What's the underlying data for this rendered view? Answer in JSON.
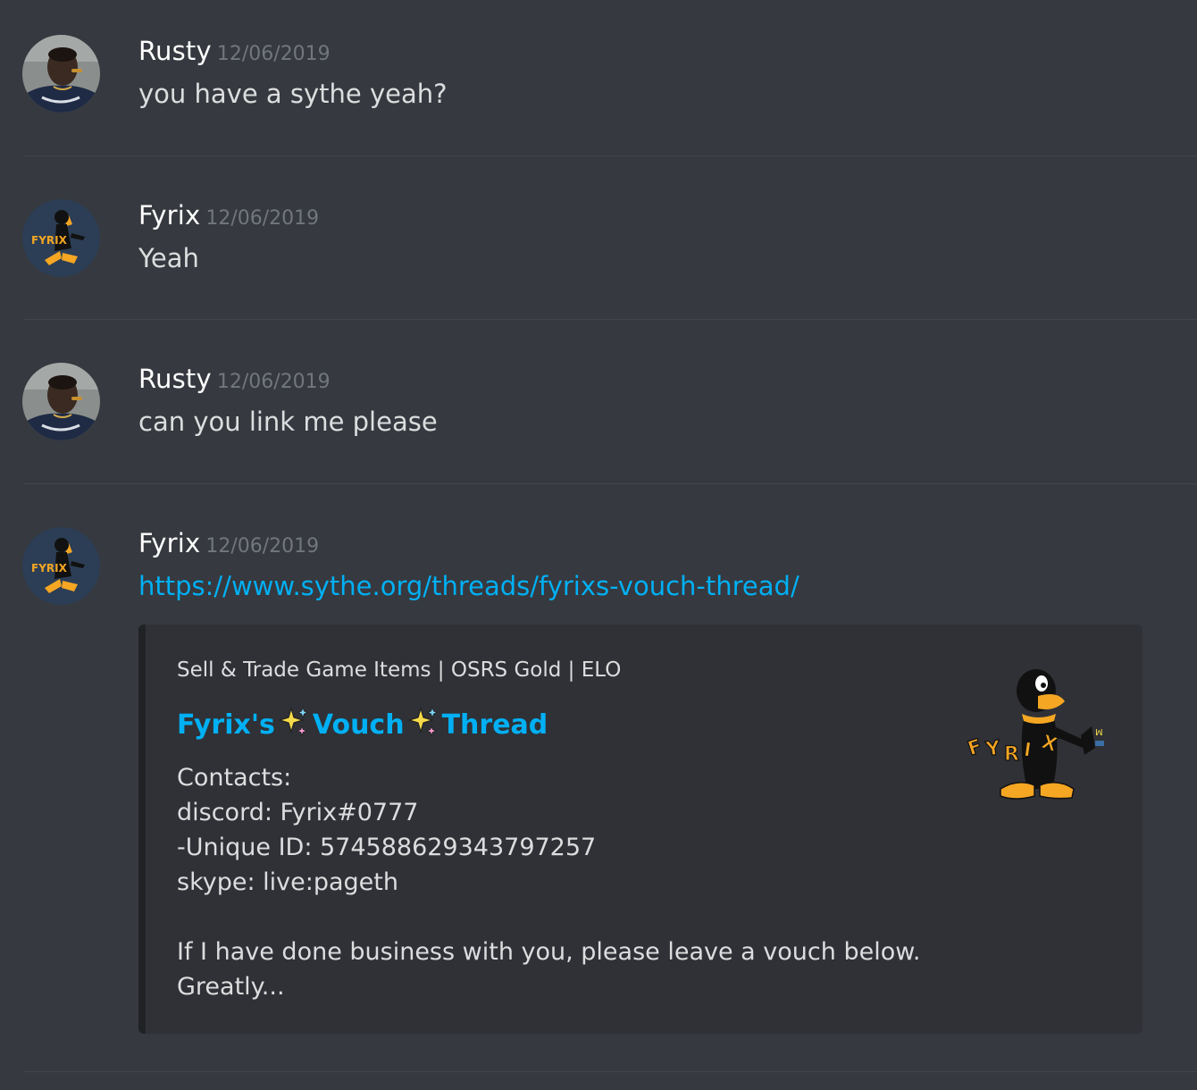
{
  "messages": [
    {
      "username": "Rusty",
      "timestamp": "12/06/2019",
      "text": "you have a sythe yeah?",
      "avatar": "rusty-avatar"
    },
    {
      "username": "Fyrix",
      "timestamp": "12/06/2019",
      "text": "Yeah",
      "avatar": "fyrix-avatar"
    },
    {
      "username": "Rusty",
      "timestamp": "12/06/2019",
      "text": "can you link me please",
      "avatar": "rusty-avatar"
    },
    {
      "username": "Fyrix",
      "timestamp": "12/06/2019",
      "link": "https://www.sythe.org/threads/fyrixs-vouch-thread/",
      "avatar": "fyrix-avatar"
    }
  ],
  "embed": {
    "provider": "Sell & Trade Game Items | OSRS Gold | ELO",
    "title_parts": [
      "Fyrix's",
      "Vouch",
      "Thread"
    ],
    "title_icon": "sparkles-icon",
    "description": "Contacts:\ndiscord: Fyrix#0777\n-Unique ID: 574588629343797257\nskype: live:pageth\n\nIf I have done business with you, please leave a vouch below.\nGreatly...",
    "thumbnail": "daffy-duck-fyrix-logo"
  },
  "colors": {
    "background": "#36393f",
    "embed_background": "#2f3136",
    "link": "#00b0f4",
    "username": "#ffffff",
    "timestamp": "#72767d",
    "text": "#dcddde"
  }
}
